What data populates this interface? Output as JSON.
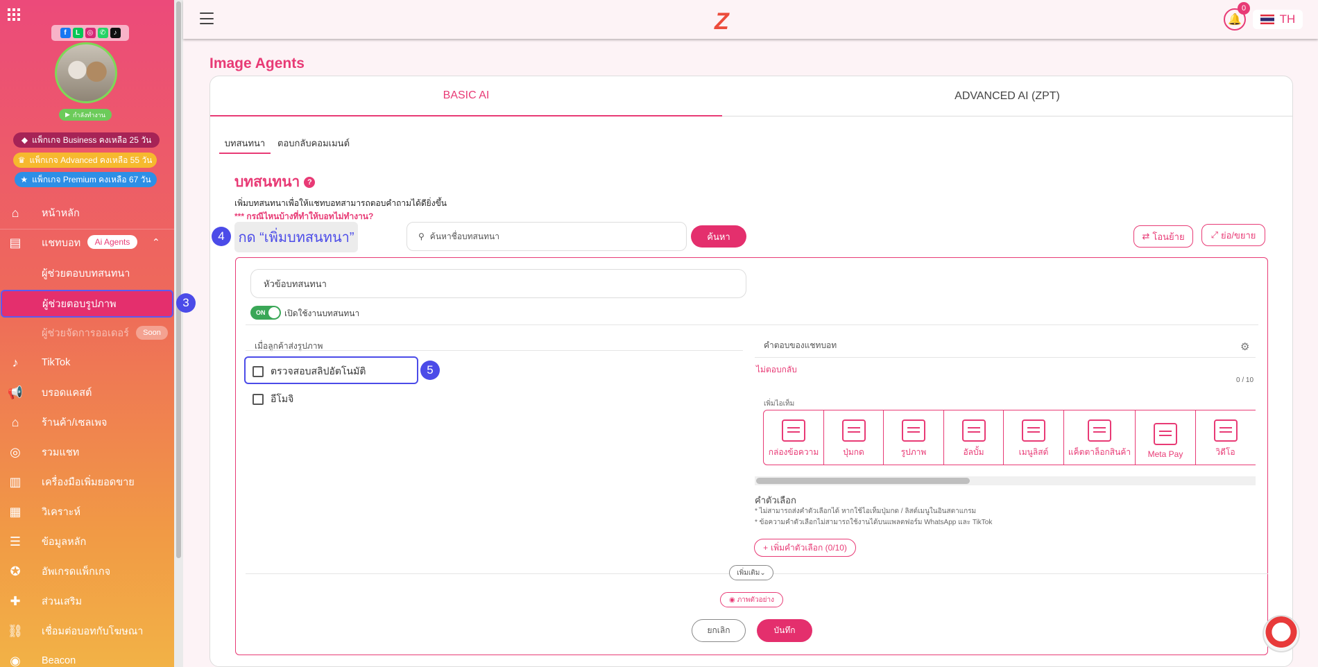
{
  "sidebar": {
    "status": "กำลังทำงาน",
    "packages": [
      {
        "label": "แพ็กเกจ Business คงเหลือ 25 วัน",
        "icon": "diamond-icon"
      },
      {
        "label": "แพ็กเกจ Advanced คงเหลือ 55 วัน",
        "icon": "crown-icon"
      },
      {
        "label": "แพ็กเกจ Premium คงเหลือ 67 วัน",
        "icon": "star-icon"
      }
    ],
    "nav": {
      "home": "หน้าหลัก",
      "chatbot": "แชทบอท",
      "ai_agents_badge": "Ai Agents",
      "sub_text_agent": "ผู้ช่วยตอบบทสนทนา",
      "sub_image_agent": "ผู้ช่วยตอบรูปภาพ",
      "sub_order_agent": "ผู้ช่วยจัดการออเดอร์",
      "soon_badge": "Soon",
      "tiktok": "TikTok",
      "broadcast": "บรอดแคสต์",
      "shop": "ร้านค้า/เซลเพจ",
      "inbox": "รวมแชท",
      "sales_tools": "เครื่องมือเพิ่มยอดขาย",
      "analytics": "วิเคราะห์",
      "master_data": "ข้อมูลหลัก",
      "upgrade": "อัพเกรดแพ็กเกจ",
      "addons": "ส่วนเสริม",
      "ads_connect": "เชื่อมต่อบอทกับโฆษณา",
      "beacon": "Beacon"
    }
  },
  "markers": {
    "three": "3",
    "four": "4",
    "five": "5"
  },
  "topbar": {
    "logo": "Z",
    "notification_count": "0",
    "lang": "TH"
  },
  "page": {
    "title": "Image Agents",
    "tabs": [
      "BASIC AI",
      "ADVANCED AI (ZPT)"
    ],
    "subtabs": [
      "บทสนทนา",
      "ตอบกลับคอมเมนต์"
    ],
    "section_title": "บทสนทนา",
    "description": "เพิ่มบทสนทนาเพื่อให้แชทบอทสามารถตอบคำถามได้ดียิ่งขึ้น",
    "warning": "*** กรณีไหนบ้างที่ทำให้บอทไม่ทำงาน?",
    "tooltip_add": "กด “เพิ่มบทสนทนา”",
    "search_placeholder": "ค้นหาชื่อบทสนทนา",
    "search_button": "ค้นหา",
    "move_button": "โอนย้าย",
    "collapse_button": "ย่อ/ขยาย"
  },
  "form": {
    "topic_placeholder": "หัวข้อบทสนทนา",
    "toggle_state": "ON",
    "toggle_label": "เปิดใช้งานบทสนทนา",
    "left_header": "เมื่อลูกค้าส่งรูปภาพ",
    "options": [
      {
        "label": "ตรวจสอบสลิปอัตโนมัติ",
        "checked": false
      },
      {
        "label": "อีโมจิ",
        "checked": false
      }
    ],
    "right_header": "คำตอบของแชทบอท",
    "no_reply": "ไม่ตอบกลับ",
    "counter": "0 / 10",
    "add_item_label": "เพิ่มไอเท็ม",
    "items": [
      {
        "label": "กล่องข้อความ",
        "icon": "text-box-icon"
      },
      {
        "label": "ปุ่มกด",
        "icon": "button-icon"
      },
      {
        "label": "รูปภาพ",
        "icon": "image-icon"
      },
      {
        "label": "อัลบั้ม",
        "icon": "album-icon"
      },
      {
        "label": "เมนูลิสต์",
        "icon": "menu-list-icon"
      },
      {
        "label": "แค็ตตาล็อกสินค้า",
        "icon": "catalog-icon"
      },
      {
        "label": "Meta Pay",
        "icon": "meta-pay-icon"
      },
      {
        "label": "วิดีโอ",
        "icon": "video-icon"
      }
    ],
    "choices_title": "คำตัวเลือก",
    "note1": "* ไม่สามารถส่งคำตัวเลือกได้ หากใช้ไอเท็มปุ่มกด / ลิสต์เมนูในอินสตาแกรม",
    "note2": "* ข้อความคำตัวเลือกไม่สามารถใช้งานได้บนแพลตฟอร์ม WhatsApp และ TikTok",
    "add_choice": "เพิ่มคำตัวเลือก (0/10)",
    "more": "เพิ่มเติม",
    "preview": "ภาพตัวอย่าง",
    "cancel": "ยกเลิก",
    "save": "บันทึก"
  }
}
